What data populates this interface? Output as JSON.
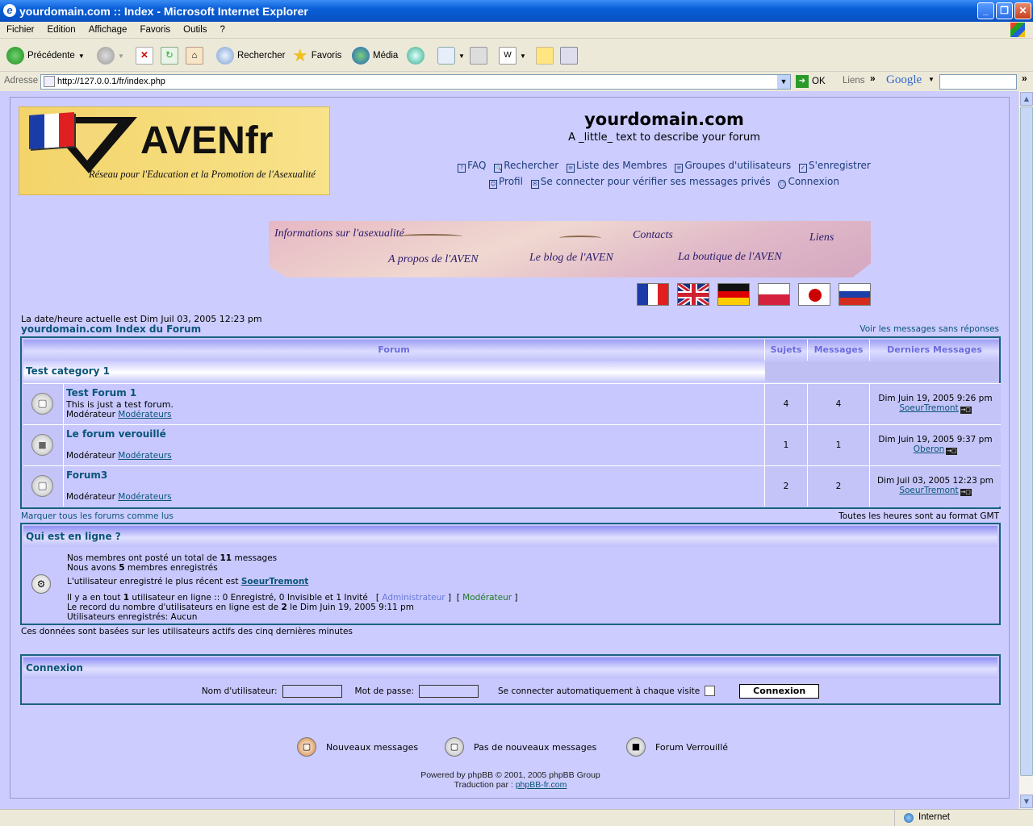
{
  "window": {
    "title": "yourdomain.com :: Index - Microsoft Internet Explorer"
  },
  "menu": [
    "Fichier",
    "Edition",
    "Affichage",
    "Favoris",
    "Outils",
    "?"
  ],
  "toolbar": {
    "back": "Précédente",
    "search": "Rechercher",
    "favorites": "Favoris",
    "media": "Média"
  },
  "address": {
    "label": "Adresse",
    "url": "http://127.0.0.1/fr/index.php",
    "go": "OK",
    "links": "Liens",
    "google": "Google"
  },
  "status": {
    "zone": "Internet"
  },
  "site": {
    "logo_brand": "AVENfr",
    "logo_tagline": "Réseau pour l'Education et la Promotion de l'Asexualité",
    "name": "yourdomain.com",
    "description": "A _little_ text to describe your forum",
    "menu_row1": [
      "FAQ",
      "Rechercher",
      "Liste des Membres",
      "Groupes d'utilisateurs",
      "S'enregistrer"
    ],
    "menu_row2": [
      "Profil",
      "Se connecter pour vérifier ses messages privés",
      "Connexion"
    ]
  },
  "banner": {
    "info": "Informations sur l'asexualité",
    "contacts": "Contacts",
    "liens": "Liens",
    "apropos": "A propos de l'AVEN",
    "blog": "Le blog de l'AVEN",
    "boutique": "La boutique de l'AVEN"
  },
  "flags": [
    "france-flag",
    "uk-flag",
    "germany-flag",
    "poland-flag",
    "japan-flag",
    "russia-flag"
  ],
  "index": {
    "current_date": "La date/heure actuelle est Dim Juil 03, 2005 12:23 pm",
    "index_link": "yourdomain.com Index du Forum",
    "unanswered": "Voir les messages sans réponses"
  },
  "table": {
    "headers": {
      "forum": "Forum",
      "topics": "Sujets",
      "posts": "Messages",
      "last": "Derniers Messages"
    },
    "category": "Test category 1",
    "moderator_label": "Modérateur",
    "forums": [
      {
        "name": "Test Forum 1",
        "desc": "This is just a test forum.",
        "mod": "Modérateurs",
        "topics": "4",
        "posts": "4",
        "last_date": "Dim Juin 19, 2005 9:26 pm",
        "last_user": "SoeurTremont",
        "icon": "○"
      },
      {
        "name": "Le forum verouillé",
        "desc": "",
        "mod": "Modérateurs",
        "topics": "1",
        "posts": "1",
        "last_date": "Dim Juin 19, 2005 9:37 pm",
        "last_user": "Oberon",
        "icon": "🔒"
      },
      {
        "name": "Forum3",
        "desc": "",
        "mod": "Modérateurs",
        "topics": "2",
        "posts": "2",
        "last_date": "Dim Juil 03, 2005 12:23 pm",
        "last_user": "SoeurTremont",
        "icon": "○"
      }
    ]
  },
  "mark_all": "Marquer tous les forums comme lus",
  "timezone": "Toutes les heures sont au format GMT",
  "online": {
    "title": "Qui est en ligne ?",
    "line1_pre": "Nos membres ont posté un total de ",
    "line1_num": "11",
    "line1_post": " messages",
    "line2_pre": "Nous avons ",
    "line2_num": "5",
    "line2_post": " membres enregistrés",
    "line3_pre": "L'utilisateur enregistré le plus récent est ",
    "line3_user": "SoeurTremont",
    "line4_pre": "Il y a en tout ",
    "line4_num": "1",
    "line4_post": " utilisateur en ligne :: 0 Enregistré, 0 Invisible et 1 Invité   [",
    "admin": "Administrateur",
    "mod": "Modérateur",
    "line5_pre": "Le record du nombre d'utilisateurs en ligne est de ",
    "line5_num": "2",
    "line5_post": " le Dim Juin 19, 2005 9:11 pm",
    "line6": "Utilisateurs enregistrés: Aucun",
    "note": "Ces données sont basées sur les utilisateurs actifs des cinq dernières minutes"
  },
  "login": {
    "title": "Connexion",
    "user_label": "Nom d'utilisateur:",
    "pass_label": "Mot de passe:",
    "auto_label": "Se connecter automatiquement à chaque visite",
    "button": "Connexion"
  },
  "legend": {
    "new": "Nouveaux messages",
    "nonew": "Pas de nouveaux messages",
    "locked": "Forum Verrouillé"
  },
  "footer": {
    "powered": "Powered by phpBB © 2001, 2005 phpBB Group",
    "translation_pre": "Traduction par : ",
    "translation_link": "phpBB-fr.com"
  }
}
